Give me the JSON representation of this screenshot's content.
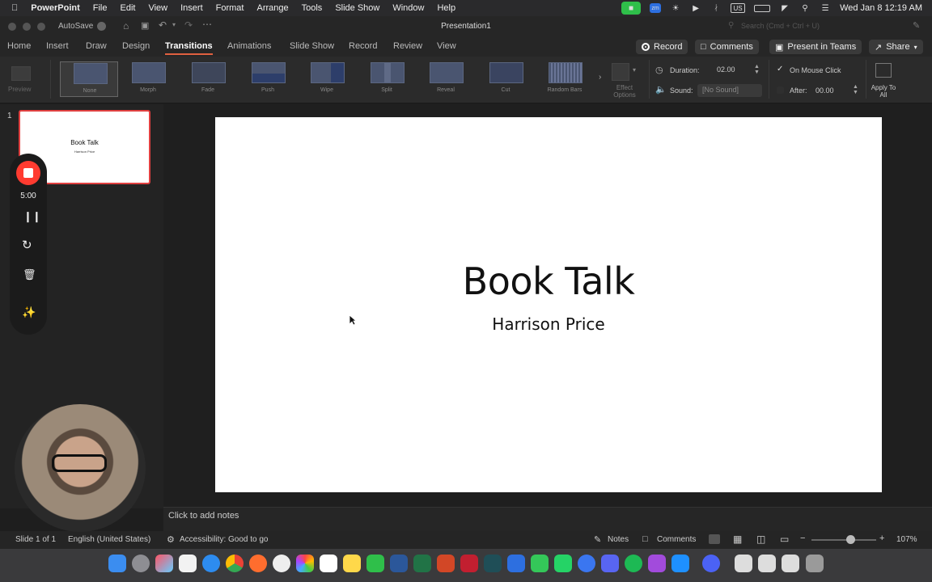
{
  "menubar": {
    "app": "PowerPoint",
    "items": [
      "File",
      "Edit",
      "View",
      "Insert",
      "Format",
      "Arrange",
      "Tools",
      "Slide Show",
      "Window",
      "Help"
    ],
    "keyboard": "US",
    "datetime": "Wed Jan 8  12:19 AM"
  },
  "titlebar": {
    "autosave": "AutoSave",
    "doc_title": "Presentation1",
    "search_placeholder": "Search (Cmd + Ctrl + U)"
  },
  "ribbon_tabs": [
    "Home",
    "Insert",
    "Draw",
    "Design",
    "Transitions",
    "Animations",
    "Slide Show",
    "Record",
    "Review",
    "View"
  ],
  "active_tab": "Transitions",
  "header_buttons": {
    "record": "Record",
    "comments": "Comments",
    "present": "Present in Teams",
    "share": "Share"
  },
  "ribbon": {
    "preview": "Preview",
    "transitions": [
      "None",
      "Morph",
      "Fade",
      "Push",
      "Wipe",
      "Split",
      "Reveal",
      "Cut",
      "Random Bars"
    ],
    "effect_options": "Effect Options",
    "duration_label": "Duration:",
    "duration_value": "02.00",
    "sound_label": "Sound:",
    "sound_value": "[No Sound]",
    "on_mouse_click": "On Mouse Click",
    "after_label": "After:",
    "after_value": "00.00",
    "apply_to_all": "Apply To All"
  },
  "thumb": {
    "index": "1",
    "title": "Book Talk",
    "subtitle": "Harrison Price"
  },
  "recorder": {
    "timer": "5:00"
  },
  "slide": {
    "title": "Book Talk",
    "subtitle": "Harrison Price"
  },
  "notes_placeholder": "Click to add notes",
  "status": {
    "slide_info": "Slide 1 of 1",
    "language": "English (United States)",
    "accessibility": "Accessibility: Good to go",
    "notes": "Notes",
    "comments": "Comments",
    "zoom": "107%",
    "zoom_level": 0.6
  },
  "colors": {
    "accent": "#e06040",
    "record_red": "#ff3b30",
    "selection_border": "#e04040"
  }
}
